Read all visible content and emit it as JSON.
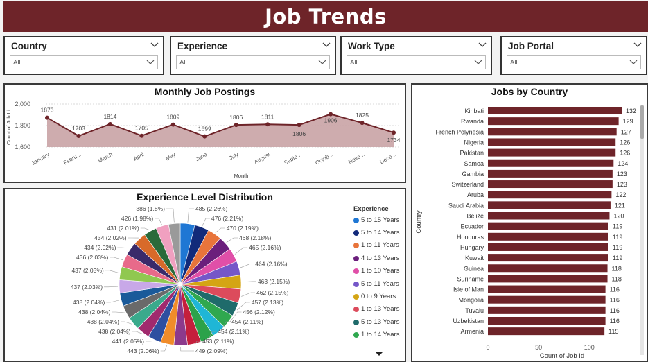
{
  "header": {
    "title": "Job Trends"
  },
  "slicers": [
    {
      "label": "Country",
      "value": "All"
    },
    {
      "label": "Experience",
      "value": "All"
    },
    {
      "label": "Work Type",
      "value": "All"
    },
    {
      "label": "Job Portal",
      "value": "All"
    }
  ],
  "colors": {
    "brand": "#6e2429",
    "area_fill": "#c9a3a5",
    "bar": "#6e2429"
  },
  "icons": {
    "slicer_toggle": "chevron-down-icon",
    "dropdown": "chevron-down-icon",
    "legend_more": "caret-down-icon"
  },
  "chart_data": [
    {
      "type": "area",
      "title": "Monthly Job Postings",
      "xlabel": "Month",
      "ylabel": "Count of Job Id",
      "categories": [
        "January",
        "Febru...",
        "March",
        "April",
        "May",
        "June",
        "July",
        "August",
        "Septe...",
        "Octob...",
        "Nove...",
        "Dece..."
      ],
      "values": [
        1873,
        1703,
        1814,
        1705,
        1809,
        1699,
        1806,
        1811,
        1806,
        1906,
        1825,
        1734
      ],
      "yticks": [
        "2,000",
        "1,800",
        "1,600"
      ],
      "ylim": [
        1600,
        2000
      ],
      "grid": true
    },
    {
      "type": "pie",
      "title": "Experience Level Distribution",
      "legend_title": "Experience",
      "legend_position": "right",
      "legend": [
        {
          "label": "5 to 15 Years",
          "color": "#1f77d4"
        },
        {
          "label": "5 to 14 Years",
          "color": "#122a7a"
        },
        {
          "label": "1 to 11 Years",
          "color": "#e8743b"
        },
        {
          "label": "4 to 13 Years",
          "color": "#6b1f7c"
        },
        {
          "label": "1 to 10 Years",
          "color": "#e04fa8"
        },
        {
          "label": "5 to 11 Years",
          "color": "#7557c8"
        },
        {
          "label": "0 to 9 Years",
          "color": "#d4a514"
        },
        {
          "label": "1 to 13 Years",
          "color": "#dc4b5c"
        },
        {
          "label": "5 to 13 Years",
          "color": "#1f6b6b"
        },
        {
          "label": "1 to 14 Years",
          "color": "#2fa84f"
        }
      ],
      "values": [
        485,
        476,
        470,
        468,
        465,
        464,
        463,
        462,
        457,
        456,
        454,
        454,
        453,
        449,
        443,
        441,
        438,
        438,
        438,
        438,
        437,
        437,
        436,
        434,
        434,
        431,
        426,
        386
      ],
      "labels": [
        "485 (2.26%)",
        "476 (2.21%)",
        "470 (2.19%)",
        "468 (2.18%)",
        "465 (2.16%)",
        "464 (2.16%)",
        "463 (2.15%)",
        "462 (2.15%)",
        "457 (2.13%)",
        "456 (2.12%)",
        "454 (2.11%)",
        "454 (2.11%)",
        "453 (2.11%)",
        "449 (2.09%)",
        "443 (2.06%)",
        "441 (2.05%)",
        "438 (2.04%)",
        "438 (2.04%)",
        "438 (2.04%)",
        "438 (2.04%)",
        "437 (2.03%)",
        "437 (2.03%)",
        "436 (2.03%)",
        "434 (2.02%)",
        "434 (2.02%)",
        "431 (2.01%)",
        "426 (1.98%)",
        "386 (1.8%)"
      ]
    },
    {
      "type": "bar",
      "title": "Jobs by Country",
      "xlabel": "Count of Job Id",
      "ylabel": "Country",
      "categories": [
        "Kiribati",
        "Rwanda",
        "French Polynesia",
        "Nigeria",
        "Pakistan",
        "Samoa",
        "Gambia",
        "Switzerland",
        "Aruba",
        "Saudi Arabia",
        "Belize",
        "Ecuador",
        "Honduras",
        "Hungary",
        "Kuwait",
        "Guinea",
        "Suriname",
        "Isle of Man",
        "Mongolia",
        "Tuvalu",
        "Uzbekistan",
        "Armenia"
      ],
      "values": [
        132,
        129,
        127,
        126,
        126,
        124,
        123,
        123,
        122,
        121,
        120,
        119,
        119,
        119,
        119,
        118,
        118,
        116,
        116,
        116,
        116,
        115
      ],
      "xticks": [
        "0",
        "50",
        "100"
      ],
      "xlim": [
        0,
        132
      ]
    }
  ]
}
